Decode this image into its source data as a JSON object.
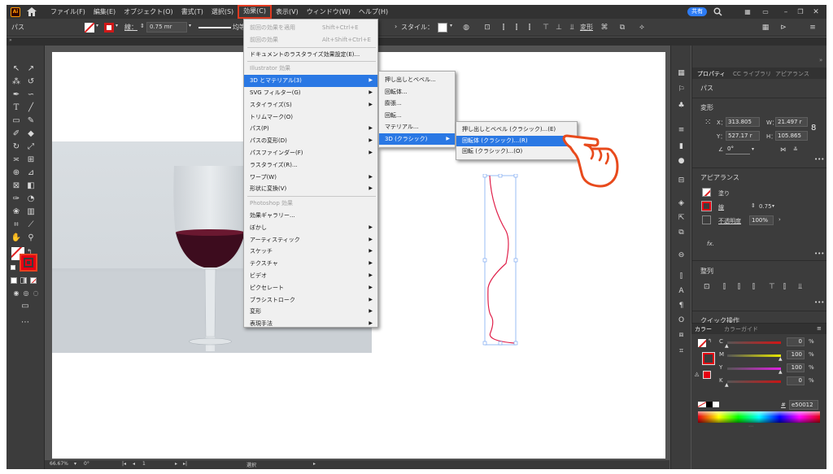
{
  "menubar": {
    "app_icon": "Ai",
    "items": [
      "ファイル(F)",
      "編集(E)",
      "オブジェクト(O)",
      "書式(T)",
      "選択(S)",
      "効果(C)",
      "表示(V)",
      "ウィンドウ(W)",
      "ヘルプ(H)"
    ],
    "active_index": 5,
    "share_label": "共有"
  },
  "controlbar": {
    "path_label": "パス",
    "stroke_label": "線：",
    "stroke_value": "0.75 mr",
    "stroke_style": "均等",
    "style_label": "スタイル：",
    "transform_label": "変形"
  },
  "effect_menu": {
    "items": [
      {
        "label": "前回の効果を適用",
        "shortcut": "Shift+Ctrl+E",
        "disabled": true
      },
      {
        "label": "前回の効果",
        "shortcut": "Alt+Shift+Ctrl+E",
        "disabled": true
      },
      {
        "label": "ドキュメントのラスタライズ効果設定(E)..."
      },
      {
        "label": "Illustrator 効果",
        "disabled": true
      },
      {
        "label": "3D とマテリアル(3)",
        "submenu": true,
        "highlighted": true
      },
      {
        "label": "SVG フィルター(G)",
        "submenu": true
      },
      {
        "label": "スタイライズ(S)",
        "submenu": true
      },
      {
        "label": "トリムマーク(O)"
      },
      {
        "label": "パス(P)",
        "submenu": true
      },
      {
        "label": "パスの変形(D)",
        "submenu": true
      },
      {
        "label": "パスファインダー(F)",
        "submenu": true
      },
      {
        "label": "ラスタライズ(R)..."
      },
      {
        "label": "ワープ(W)",
        "submenu": true
      },
      {
        "label": "形状に変換(V)",
        "submenu": true
      },
      {
        "label": "Photoshop 効果",
        "disabled": true
      },
      {
        "label": "効果ギャラリー..."
      },
      {
        "label": "ぼかし",
        "submenu": true
      },
      {
        "label": "アーティスティック",
        "submenu": true
      },
      {
        "label": "スケッチ",
        "submenu": true
      },
      {
        "label": "テクスチャ",
        "submenu": true
      },
      {
        "label": "ビデオ",
        "submenu": true
      },
      {
        "label": "ピクセレート",
        "submenu": true
      },
      {
        "label": "ブラシストローク",
        "submenu": true
      },
      {
        "label": "変形",
        "submenu": true
      },
      {
        "label": "表現手法",
        "submenu": true
      }
    ]
  },
  "submenu_3d": {
    "items": [
      {
        "label": "押し出しとベベル..."
      },
      {
        "label": "回転体..."
      },
      {
        "label": "膨張..."
      },
      {
        "label": "回転..."
      },
      {
        "label": "マテリアル..."
      },
      {
        "label": "3D (クラシック)",
        "submenu": true,
        "highlighted": true
      }
    ]
  },
  "submenu_classic": {
    "items": [
      {
        "label": "押し出しとベベル (クラシック)...(E)"
      },
      {
        "label": "回転体 (クラシック)...(R)",
        "highlighted": true
      },
      {
        "label": "回転 (クラシック)...(O)"
      }
    ]
  },
  "properties": {
    "tabs": [
      "プロパティ",
      "CC ライブラリ",
      "アピアランス"
    ],
    "selection": "パス",
    "transform_title": "変形",
    "x_label": "X：",
    "x_value": "313.805",
    "w_label": "W：",
    "w_value": "21.497 r",
    "y_label": "Y：",
    "y_value": "527.17 r",
    "h_label": "H：",
    "h_value": "105.865",
    "angle_value": "0°",
    "appearance_title": "アピアランス",
    "fill_label": "塗り",
    "stroke_label": "線",
    "stroke_value": "0.75",
    "opacity_label": "不透明度",
    "opacity_value": "100%",
    "fx_label": "fx.",
    "align_title": "整列",
    "quick_actions": "クイック操作"
  },
  "color_panel": {
    "tabs": [
      "カラー",
      "カラーガイド"
    ],
    "channels": [
      {
        "label": "C",
        "value": "0",
        "color": "#d21515"
      },
      {
        "label": "M",
        "value": "100",
        "color": "#e8e800"
      },
      {
        "label": "Y",
        "value": "100",
        "color": "#e020e0"
      },
      {
        "label": "K",
        "value": "0",
        "color": "#c81515"
      }
    ],
    "unit": "%",
    "hex": "e50012"
  },
  "statusbar": {
    "zoom": "66.67%",
    "rotation": "0°",
    "page": "1",
    "tool": "選択"
  },
  "colors": {
    "accent_red": "#e50012",
    "highlight_blue": "#2a78e4",
    "share_blue": "#2d7cf6"
  }
}
